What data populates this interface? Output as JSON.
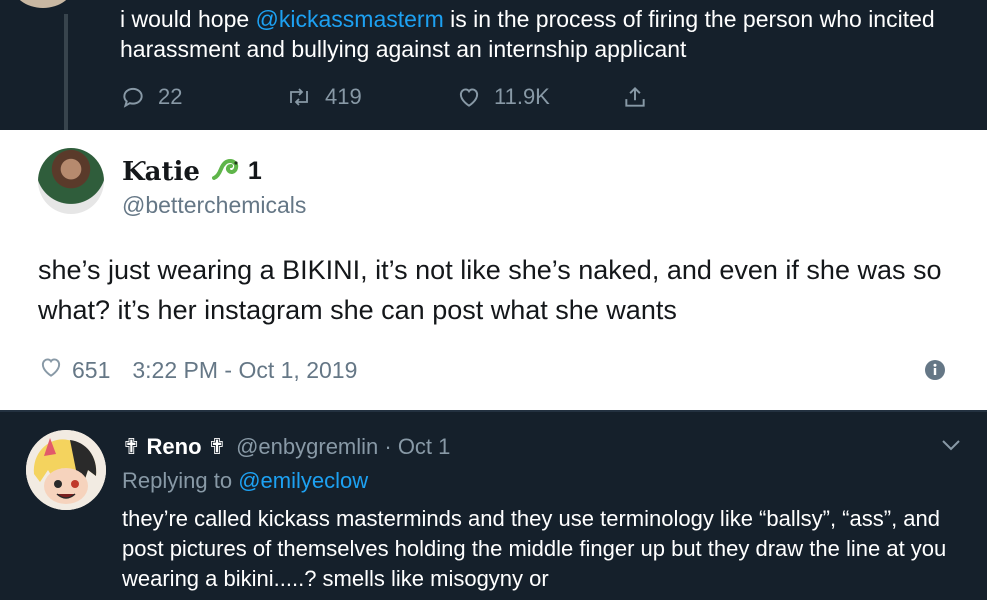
{
  "top_tweet": {
    "text_before": "i would hope ",
    "mention": "@kickassmasterm",
    "text_after": " is in the process of firing the person who incited harassment and bullying against an internship applicant",
    "replies": "22",
    "retweets": "419",
    "likes": "11.9K"
  },
  "middle_tweet": {
    "display_name": "Ƙatie",
    "name_suffix": "1",
    "handle": "@betterchemicals",
    "text": "she’s just wearing a BIKINI, it’s not like she’s naked, and even if she was so what? it’s her instagram she can post what she wants",
    "likes": "651",
    "timestamp": "3:22 PM - Oct 1, 2019"
  },
  "bottom_tweet": {
    "display_name": "✟ Reno ✟",
    "handle_date": "@enbygremlin · Oct 1",
    "replying_label": "Replying to ",
    "replying_mention": "@emilyeclow",
    "text": "they’re called kickass masterminds and they use terminology like “ballsy”, “ass”, and post pictures of themselves holding the middle finger up but they draw the line at you wearing a bikini.....? smells like misogyny or"
  },
  "colors": {
    "dark_bg": "#15202b",
    "accent": "#1da1f2",
    "muted": "#8899a6",
    "light_bg": "#ffffff"
  },
  "icons": [
    "reply-icon",
    "retweet-icon",
    "like-icon",
    "share-icon",
    "snake-emoji-icon",
    "info-icon",
    "chevron-down-icon"
  ]
}
